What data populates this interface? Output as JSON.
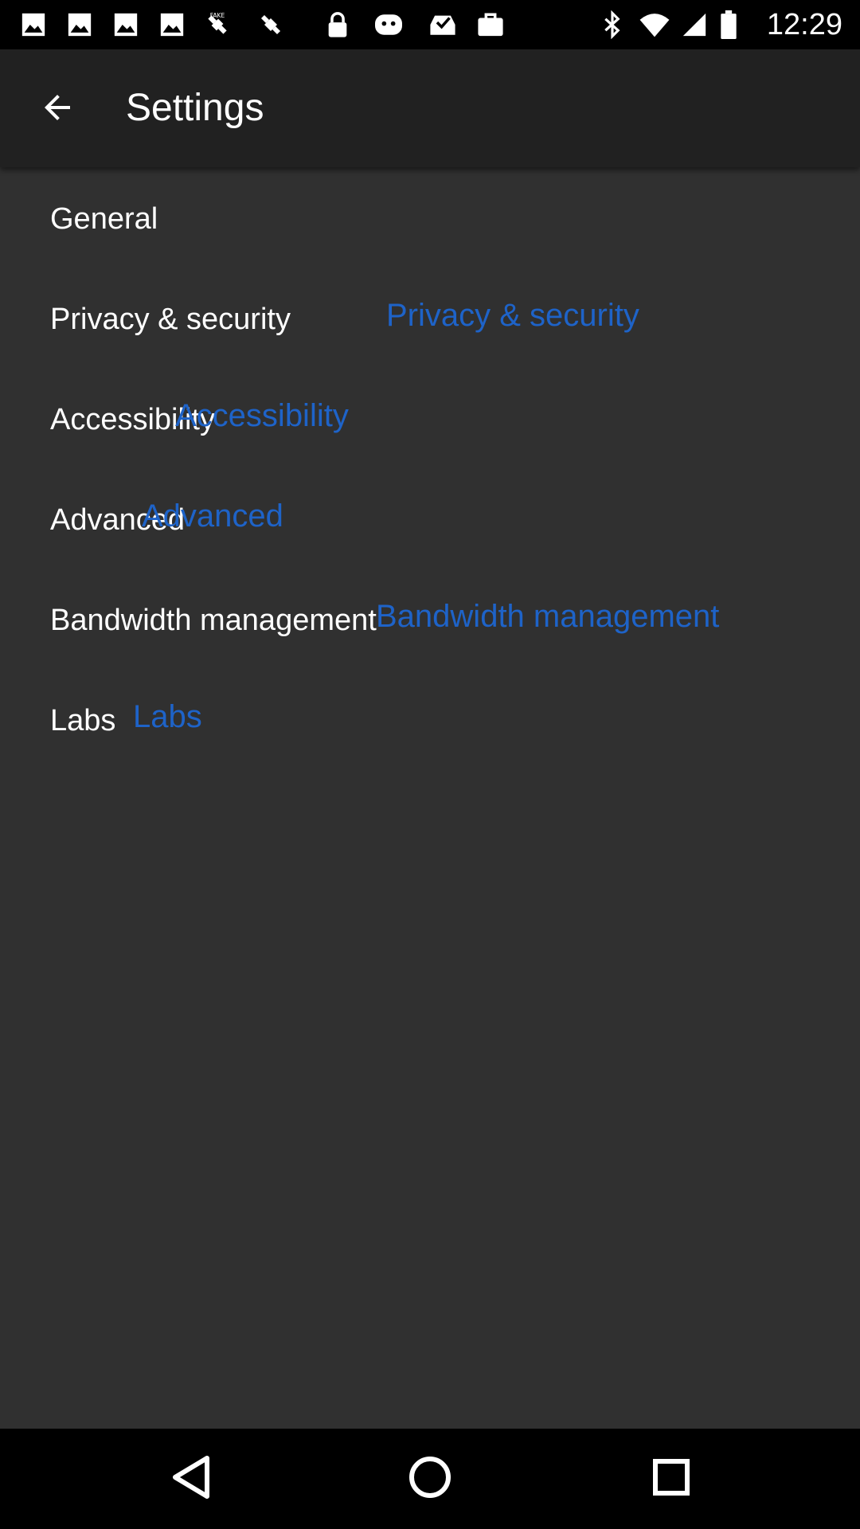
{
  "status_bar": {
    "time": "12:29",
    "icons": [
      "image-icon",
      "image-icon",
      "fake-gps-icon",
      "satellite-icon",
      "lock-icon",
      "app-icon",
      "inbox-check-icon",
      "briefcase-icon",
      "bluetooth-icon",
      "wifi-icon",
      "signal-icon",
      "battery-icon"
    ]
  },
  "app_bar": {
    "back_icon": "arrow-back-icon",
    "title": "Settings"
  },
  "settings": {
    "items": [
      {
        "label": "General",
        "summary": ""
      },
      {
        "label": "Privacy & security",
        "summary": "Privacy & security"
      },
      {
        "label": "Accessibility",
        "summary": "Accessibility"
      },
      {
        "label": "Advanced",
        "summary": "Advanced"
      },
      {
        "label": "Bandwidth management",
        "summary": "Bandwidth management"
      },
      {
        "label": "Labs",
        "summary": "Labs"
      }
    ]
  },
  "colors": {
    "app_bar": "#212121",
    "background": "#303030",
    "summary_text": "#1e63c8",
    "label_text": "#ffffff"
  },
  "nav_bar": {
    "buttons": [
      "back-triangle-icon",
      "home-circle-icon",
      "recents-square-icon"
    ]
  }
}
